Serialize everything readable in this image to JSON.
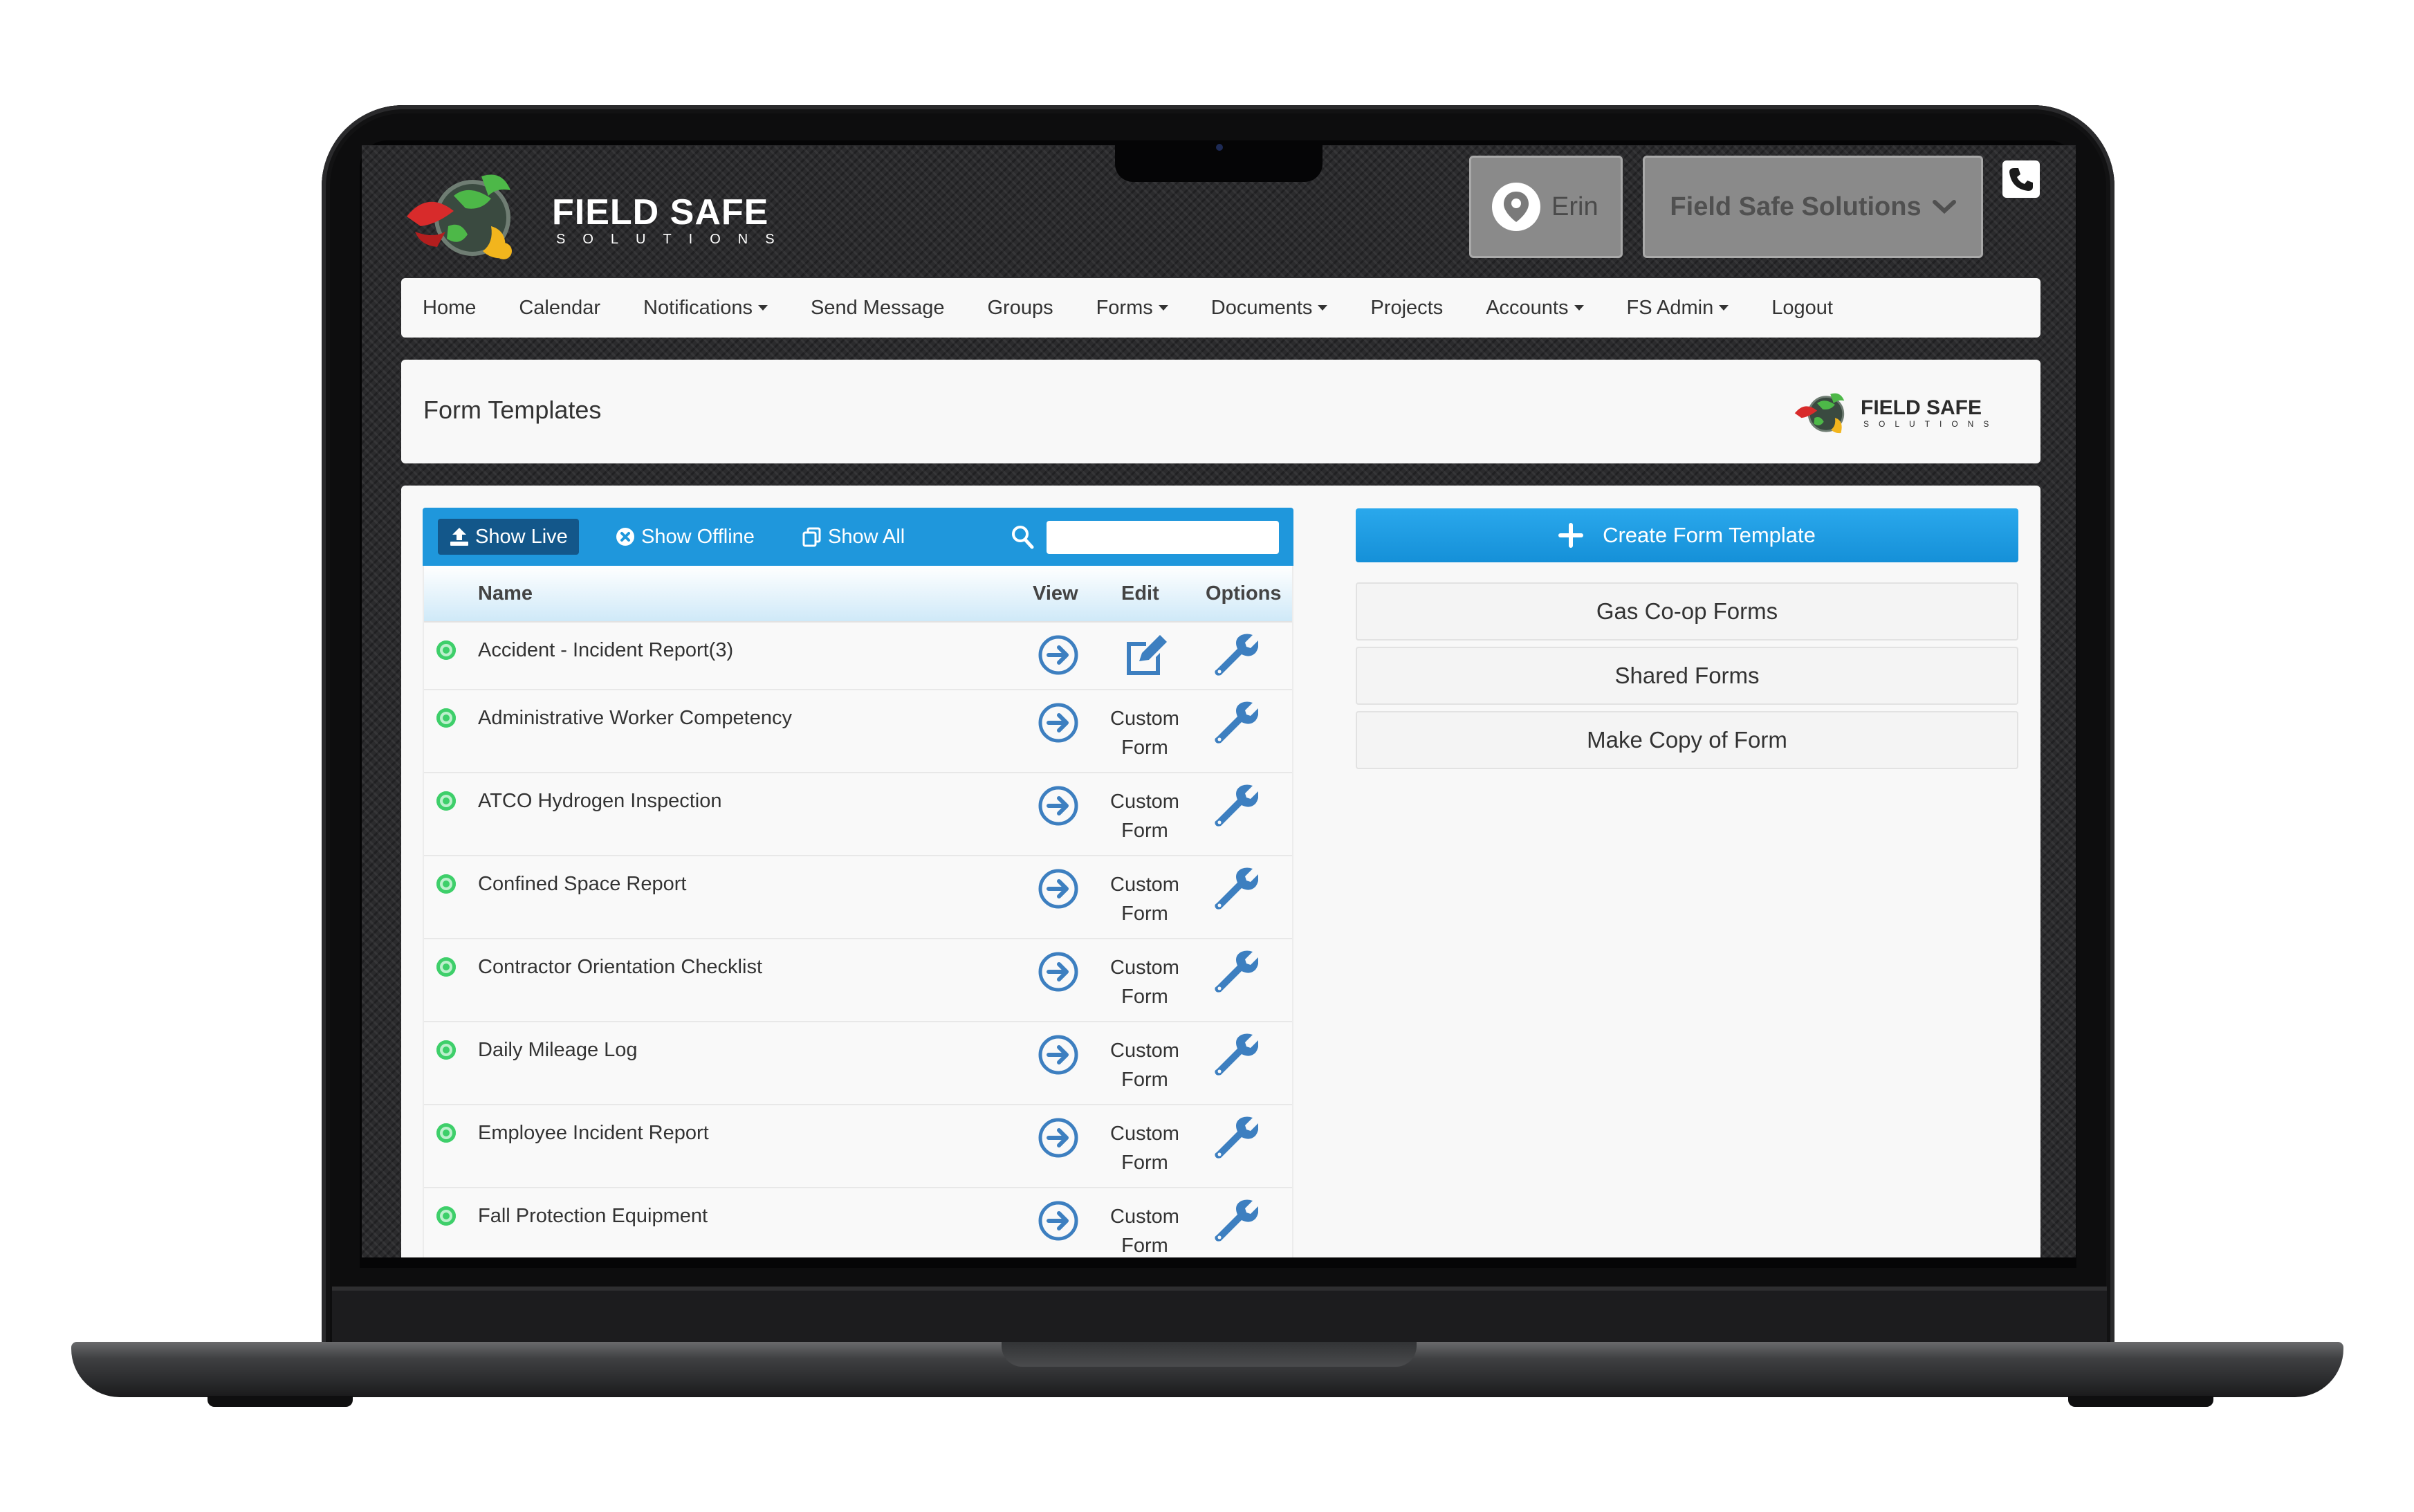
{
  "header": {
    "brand_title": "FIELD SAFE",
    "brand_sub": "SOLUTIONS",
    "location_user": "Erin",
    "company": "Field Safe Solutions"
  },
  "nav": {
    "items": [
      {
        "label": "Home",
        "dropdown": false
      },
      {
        "label": "Calendar",
        "dropdown": false
      },
      {
        "label": "Notifications",
        "dropdown": true
      },
      {
        "label": "Send Message",
        "dropdown": false
      },
      {
        "label": "Groups",
        "dropdown": false
      },
      {
        "label": "Forms",
        "dropdown": true
      },
      {
        "label": "Documents",
        "dropdown": true
      },
      {
        "label": "Projects",
        "dropdown": false
      },
      {
        "label": "Accounts",
        "dropdown": true
      },
      {
        "label": "FS Admin",
        "dropdown": true
      },
      {
        "label": "Logout",
        "dropdown": false
      }
    ]
  },
  "page": {
    "title": "Form Templates",
    "logo_title": "FIELD SAFE",
    "logo_sub": "SOLUTIONS"
  },
  "toolbar": {
    "show_live": "Show Live",
    "show_offline": "Show Offline",
    "show_all": "Show All",
    "search_value": ""
  },
  "table": {
    "columns": {
      "name": "Name",
      "view": "View",
      "edit": "Edit",
      "options": "Options"
    },
    "rows": [
      {
        "name": "Accident - Incident Report(3)",
        "edit": "icon"
      },
      {
        "name": "Administrative Worker Competency",
        "edit": "Custom Form"
      },
      {
        "name": "ATCO Hydrogen Inspection",
        "edit": "Custom Form"
      },
      {
        "name": "Confined Space Report",
        "edit": "Custom Form"
      },
      {
        "name": "Contractor Orientation Checklist",
        "edit": "Custom Form"
      },
      {
        "name": "Daily Mileage Log",
        "edit": "Custom Form"
      },
      {
        "name": "Employee Incident Report",
        "edit": "Custom Form"
      },
      {
        "name": "Fall Protection Equipment",
        "edit": "Custom Form"
      }
    ]
  },
  "sidebar": {
    "create": "Create Form Template",
    "gas_coop": "Gas Co-op Forms",
    "shared": "Shared Forms",
    "make_copy": "Make Copy of Form"
  },
  "colors": {
    "toolbar_blue": "#1f97dc",
    "active_button": "#13578a",
    "action_icon_blue": "#3d7fc0",
    "live_status_green": "#3ecf6a"
  }
}
